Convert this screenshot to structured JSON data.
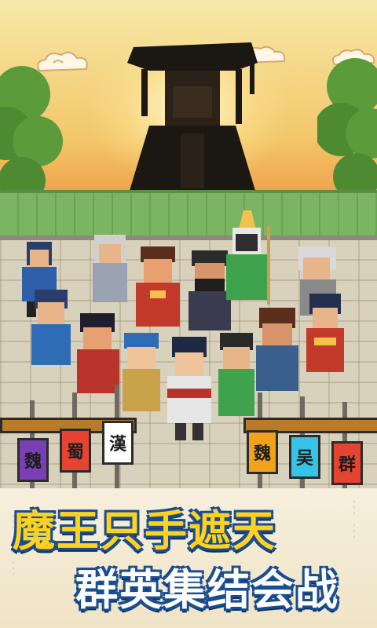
{
  "scene": {
    "colors": {
      "sky_top": "#f6e9a8",
      "sky_bottom": "#e8773a",
      "wall": "#7bb463",
      "ground": "#d8d1bb",
      "accent": "#ffd21f",
      "outline": "#1a4d8f"
    }
  },
  "banners": {
    "left": [
      {
        "char": "魏",
        "color": "#7b3fb4"
      },
      {
        "char": "蜀",
        "color": "#e64433"
      },
      {
        "char": "漢",
        "color": "#ffffff"
      }
    ],
    "right": [
      {
        "char": "魏",
        "color": "#f2a21a"
      },
      {
        "char": "吴",
        "color": "#36c3e8"
      },
      {
        "char": "群",
        "color": "#e64433"
      }
    ]
  },
  "headline": {
    "line1": "魔王只手遮天",
    "line2": "群英集结会战"
  },
  "characters": [
    "warlord-silhouette",
    "hero-blue",
    "hero-white-hair",
    "hero-red",
    "hero-black-beard",
    "hero-green-gold",
    "hero-grey-elder",
    "hero-blue-2",
    "hero-blue-3",
    "hero-red-2",
    "hero-bearded-brown",
    "hero-fan-girl",
    "hero-center",
    "hero-young",
    "hero-green-2"
  ]
}
